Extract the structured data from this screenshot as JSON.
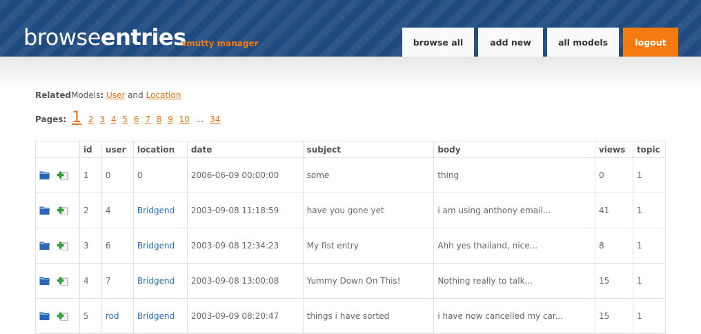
{
  "header": {
    "title_light": "browse",
    "title_bold": "entries",
    "tagline": "smutty manager"
  },
  "nav": [
    {
      "label": "browse all"
    },
    {
      "label": "add new"
    },
    {
      "label": "all models"
    },
    {
      "label": "logout",
      "active": true
    }
  ],
  "related": {
    "label_bold": "Related",
    "label_rest": "Models",
    "colon": ":",
    "user": "User",
    "and": "and",
    "location": "Location"
  },
  "pages": {
    "label": "Pages:",
    "current": "1",
    "list": [
      "2",
      "3",
      "4",
      "5",
      "6",
      "7",
      "8",
      "9",
      "10"
    ],
    "ellipsis": "...",
    "last": "34"
  },
  "table": {
    "columns": [
      "id",
      "user",
      "location",
      "date",
      "subject",
      "body",
      "views",
      "topic"
    ],
    "rows": [
      {
        "id": "1",
        "user": "0",
        "user_link": false,
        "location": "0",
        "location_link": false,
        "date": "2006-06-09 00:00:00",
        "subject": "some",
        "body": "thing",
        "views": "0",
        "topic": "1"
      },
      {
        "id": "2",
        "user": "4",
        "user_link": false,
        "location": "Bridgend",
        "location_link": true,
        "date": "2003-09-08 11:18:59",
        "subject": "have you gone yet",
        "body": "i am using anthony email...",
        "views": "41",
        "topic": "1"
      },
      {
        "id": "3",
        "user": "6",
        "user_link": false,
        "location": "Bridgend",
        "location_link": true,
        "date": "2003-09-08 12:34:23",
        "subject": "My fist entry",
        "body": "Ahh yes thailand, nice...",
        "views": "8",
        "topic": "1"
      },
      {
        "id": "4",
        "user": "7",
        "user_link": false,
        "location": "Bridgend",
        "location_link": true,
        "date": "2003-09-08 13:00:08",
        "subject": "Yummy Down On This!",
        "body": "Nothing really to talk...",
        "views": "15",
        "topic": "1"
      },
      {
        "id": "5",
        "user": "rod",
        "user_link": true,
        "location": "Bridgend",
        "location_link": true,
        "date": "2003-09-09 08:20:47",
        "subject": "things i have sorted",
        "body": "i have now cancelled my car...",
        "views": "15",
        "topic": "1"
      }
    ]
  },
  "icons": {
    "view": "folder-view-icon",
    "add": "add-document-icon",
    "folder_color": "#2a66b8",
    "add_color": "#2fa33a"
  },
  "colors": {
    "header_bg": "#1f4c80",
    "accent": "#f57a0f",
    "link_orange": "#e57413",
    "link_blue": "#2b6fb6"
  }
}
